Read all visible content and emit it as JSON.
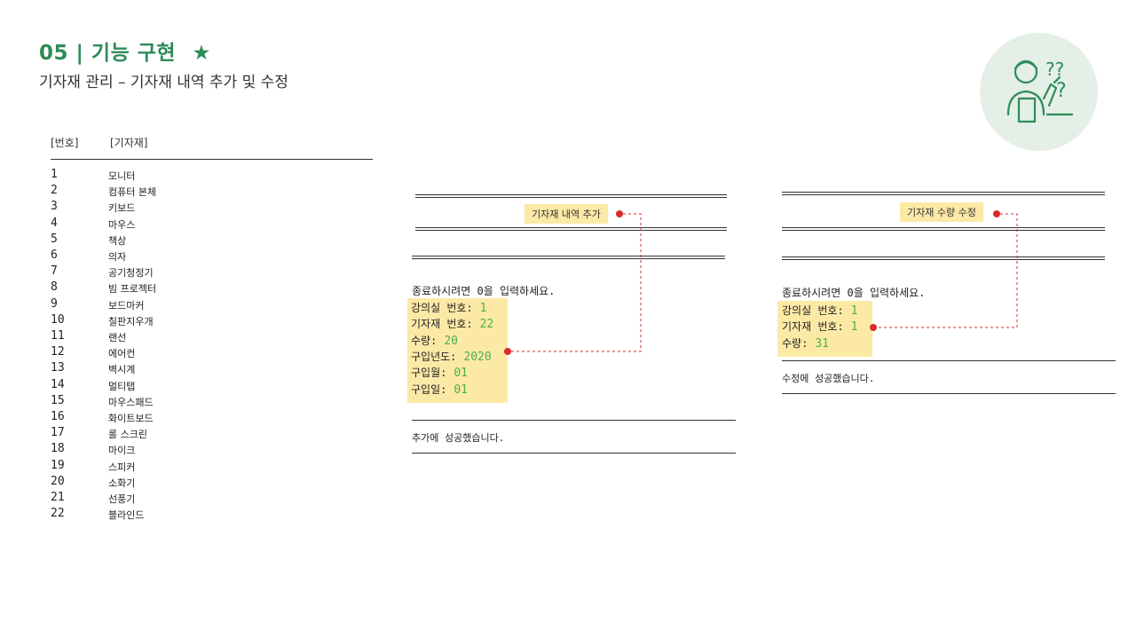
{
  "header": {
    "title": "05 | 기능 구현",
    "star": "★",
    "subtitle": "기자재 관리 – 기자재 내역 추가 및 수정"
  },
  "list": {
    "col_num": "[번호]",
    "col_name": "[기자재]",
    "items": [
      {
        "num": "1",
        "name": "모니터"
      },
      {
        "num": "2",
        "name": "컴퓨터 본체"
      },
      {
        "num": "3",
        "name": "키보드"
      },
      {
        "num": "4",
        "name": "마우스"
      },
      {
        "num": "5",
        "name": "책상"
      },
      {
        "num": "6",
        "name": "의자"
      },
      {
        "num": "7",
        "name": "공기청정기"
      },
      {
        "num": "8",
        "name": "빔 프로젝터"
      },
      {
        "num": "9",
        "name": "보드마커"
      },
      {
        "num": "10",
        "name": "칠판지우개"
      },
      {
        "num": "11",
        "name": "랜선"
      },
      {
        "num": "12",
        "name": "에어컨"
      },
      {
        "num": "13",
        "name": "벽시계"
      },
      {
        "num": "14",
        "name": "멀티탭"
      },
      {
        "num": "15",
        "name": "마우스패드"
      },
      {
        "num": "16",
        "name": "화이트보드"
      },
      {
        "num": "17",
        "name": "롤 스크린"
      },
      {
        "num": "18",
        "name": "마이크"
      },
      {
        "num": "19",
        "name": "스피커"
      },
      {
        "num": "20",
        "name": "소화기"
      },
      {
        "num": "21",
        "name": "선풍기"
      },
      {
        "num": "22",
        "name": "블라인드"
      }
    ]
  },
  "add_panel": {
    "menu_label": "기자재 내역 추가",
    "exit_prompt": "종료하시려면 0을 입력하세요.",
    "fields": [
      {
        "label": "강의실 번호:",
        "value": "1"
      },
      {
        "label": "기자재 번호:",
        "value": "22"
      },
      {
        "label": "수량:",
        "value": "20"
      },
      {
        "label": "구입년도:",
        "value": "2020"
      },
      {
        "label": "구입월:",
        "value": "01"
      },
      {
        "label": "구입일:",
        "value": "01"
      }
    ],
    "result": "추가에 성공했습니다."
  },
  "edit_panel": {
    "menu_label": "기자재 수량 수정",
    "exit_prompt": "종료하시려면 0을 입력하세요.",
    "fields": [
      {
        "label": "강의실 번호:",
        "value": "1"
      },
      {
        "label": "기자재 번호:",
        "value": "1"
      },
      {
        "label": "수량:",
        "value": "31"
      }
    ],
    "result": "수정에 성공했습니다."
  },
  "colors": {
    "accent": "#2e8b57",
    "highlight": "#fde9a6",
    "value_green": "#4caf50",
    "connector_red": "#d92b2b",
    "avatar_bg": "#e3efe7"
  },
  "icons": {
    "avatar": "thinking-person-icon"
  }
}
